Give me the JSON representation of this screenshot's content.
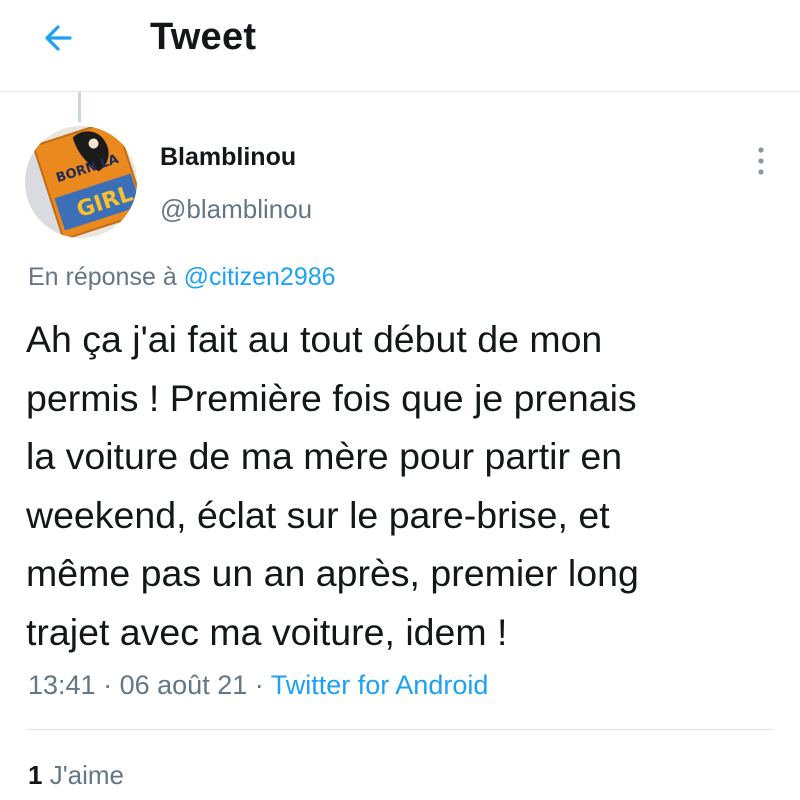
{
  "header": {
    "title": "Tweet",
    "back_icon": "arrow-left-icon"
  },
  "tweet": {
    "avatar_text_top": "BORN LA",
    "avatar_text_bottom": "GIRL",
    "display_name": "Blamblinou",
    "username": "@blamblinou",
    "more_icon": "more-vertical-icon",
    "reply_prefix": "En réponse à",
    "reply_mention": "@citizen2986",
    "text_lines": [
      "Ah ça j'ai fait au tout début de mon",
      "permis ! Première fois que je prenais",
      "la voiture de ma mère pour partir en",
      "weekend, éclat sur le pare-brise, et",
      "même pas un an après, premier long",
      "trajet avec ma voiture, idem !"
    ],
    "time": "13:41",
    "separator": "·",
    "date": "06 août 21",
    "source": "Twitter for Android",
    "like_count": "1",
    "like_label": "J'aime"
  },
  "colors": {
    "accent": "#1da1f2",
    "secondary_text": "#657786",
    "primary_text": "#14171a",
    "divider": "#e3e6e8"
  }
}
